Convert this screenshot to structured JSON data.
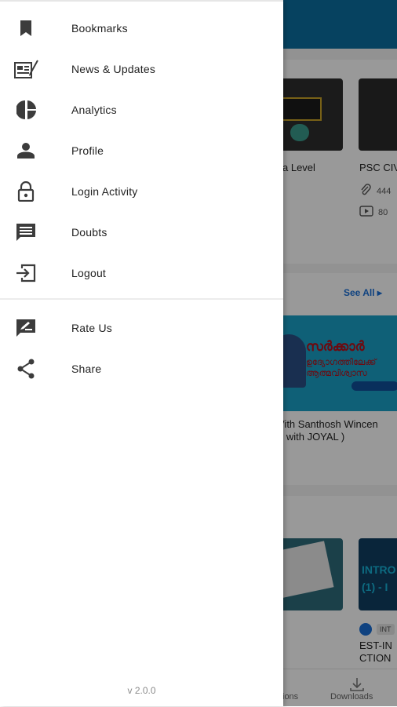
{
  "drawer": {
    "menu_items": [
      {
        "label": "Bookmarks",
        "icon": "bookmark-icon"
      },
      {
        "label": "News & Updates",
        "icon": "news-icon"
      },
      {
        "label": "Analytics",
        "icon": "pie-chart-icon"
      },
      {
        "label": "Profile",
        "icon": "person-icon"
      },
      {
        "label": "Login Activity",
        "icon": "lock-icon"
      },
      {
        "label": "Doubts",
        "icon": "chat-icon"
      },
      {
        "label": "Logout",
        "icon": "logout-icon"
      }
    ],
    "secondary_items": [
      {
        "label": "Rate Us",
        "icon": "rate-icon"
      },
      {
        "label": "Share",
        "icon": "share-icon"
      }
    ],
    "version": "v 2.0.0"
  },
  "background": {
    "course_cards": [
      {
        "title": "a Level"
      },
      {
        "title": "PSC CIV",
        "meta1": "444",
        "meta2": "80"
      }
    ],
    "see_all": "See All",
    "banner": {
      "headline": "സർക്കാർ",
      "subline": "ഉദ്യോഗത്തിലേക്ക്",
      "subline2": "ആത്മവിശ്വാസ"
    },
    "captions": [
      "Vith Santhosh Wincen",
      "n with JOYAL )"
    ],
    "lower_card": {
      "title_line1": "EST-IN",
      "title_line2": "CTION",
      "banner_text": "INTRO",
      "banner_text2": "(1) - I",
      "tag": "INT"
    },
    "bottom_nav": [
      "ions",
      "Downloads"
    ]
  },
  "colors": {
    "accent": "#0b6fa0",
    "link": "#1a6fd6",
    "icon": "#3c3c3c",
    "text": "#222222"
  }
}
